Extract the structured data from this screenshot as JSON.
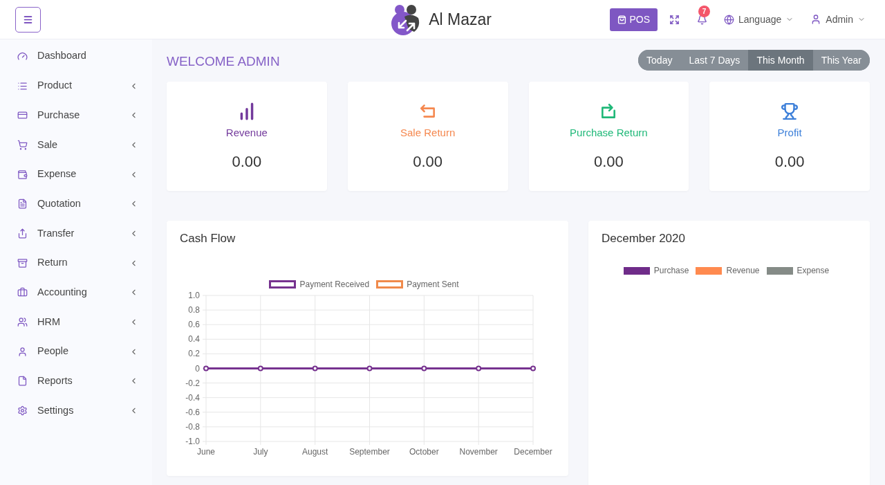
{
  "header": {
    "logo_text": "Al Mazar",
    "pos_button": "POS",
    "notification_count": "7",
    "language": "Language",
    "user": "Admin"
  },
  "sidebar": {
    "items": [
      {
        "label": "Dashboard",
        "submenu": false
      },
      {
        "label": "Product",
        "submenu": true
      },
      {
        "label": "Purchase",
        "submenu": true
      },
      {
        "label": "Sale",
        "submenu": true
      },
      {
        "label": "Expense",
        "submenu": true
      },
      {
        "label": "Quotation",
        "submenu": true
      },
      {
        "label": "Transfer",
        "submenu": true
      },
      {
        "label": "Return",
        "submenu": true
      },
      {
        "label": "Accounting",
        "submenu": true
      },
      {
        "label": "HRM",
        "submenu": true
      },
      {
        "label": "People",
        "submenu": true
      },
      {
        "label": "Reports",
        "submenu": true
      },
      {
        "label": "Settings",
        "submenu": true
      }
    ]
  },
  "page_title": "WELCOME ADMIN",
  "period_tabs": [
    {
      "label": "Today",
      "selected": false
    },
    {
      "label": "Last 7 Days",
      "selected": false
    },
    {
      "label": "This Month",
      "selected": true
    },
    {
      "label": "This Year",
      "selected": false
    }
  ],
  "stats": [
    {
      "label": "Revenue",
      "value": "0.00",
      "color": "#733a9c"
    },
    {
      "label": "Sale Return",
      "value": "0.00",
      "color": "#f5884f"
    },
    {
      "label": "Purchase Return",
      "value": "0.00",
      "color": "#1fb878"
    },
    {
      "label": "Profit",
      "value": "0.00",
      "color": "#3c7fd9"
    }
  ],
  "cash_flow": {
    "title": "Cash Flow",
    "legend_items": [
      {
        "label": "Payment Received",
        "color": "#76328f"
      },
      {
        "label": "Payment Sent",
        "color": "#f08a4b"
      }
    ],
    "chart_data": {
      "type": "line",
      "categories": [
        "June",
        "July",
        "August",
        "September",
        "October",
        "November",
        "December"
      ],
      "series": [
        {
          "color": "#76328f",
          "values": [
            0,
            0,
            0,
            0,
            0,
            0,
            0
          ]
        }
      ],
      "ylim": [
        -1,
        1
      ],
      "yticks": [
        {
          "value": 1,
          "label": "1.0"
        },
        {
          "value": 0.8,
          "label": "0.8"
        },
        {
          "value": 0.6,
          "label": "0.6"
        },
        {
          "value": 0.4,
          "label": "0.4"
        },
        {
          "value": 0.2,
          "label": "0.2"
        },
        {
          "value": 0,
          "label": "0"
        },
        {
          "value": -0.2,
          "label": "-0.2"
        },
        {
          "value": -0.4,
          "label": "-0.4"
        },
        {
          "value": -0.6,
          "label": "-0.6"
        },
        {
          "value": -0.8,
          "label": "-0.8"
        },
        {
          "value": -1,
          "label": "-1.0"
        }
      ],
      "grid": true,
      "marker": "circle"
    }
  },
  "monthly_summary": {
    "title": "December 2020",
    "legend": [
      {
        "label": "Purchase",
        "color": "#6f2c89"
      },
      {
        "label": "Revenue",
        "color": "#ff8a4f"
      },
      {
        "label": "Expense",
        "color": "#858b87"
      }
    ]
  }
}
